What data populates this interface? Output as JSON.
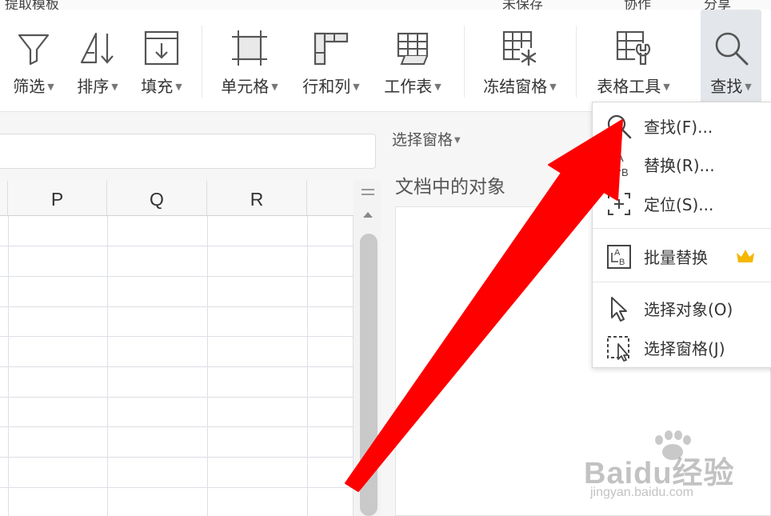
{
  "top_strip": {
    "left_text": "提取模板",
    "mid_text": "未保存",
    "mid2_text": "协作",
    "right_text": "分享"
  },
  "toolbar": {
    "tools": [
      {
        "label": "筛选",
        "icon": "filter-icon"
      },
      {
        "label": "排序",
        "icon": "sort-icon"
      },
      {
        "label": "填充",
        "icon": "fill-icon"
      },
      {
        "label": "单元格",
        "icon": "cell-icon"
      },
      {
        "label": "行和列",
        "icon": "rows-columns-icon"
      },
      {
        "label": "工作表",
        "icon": "worksheet-icon"
      },
      {
        "label": "冻结窗格",
        "icon": "freeze-panes-icon"
      },
      {
        "label": "表格工具",
        "icon": "table-tools-icon"
      },
      {
        "label": "查找",
        "icon": "search-icon"
      }
    ]
  },
  "sheet": {
    "columns": [
      "P",
      "Q",
      "R"
    ]
  },
  "pane": {
    "header": "选择窗格",
    "title": "文档中的对象"
  },
  "find_menu": {
    "items": [
      {
        "label": "查找(F)...",
        "icon": "search-icon"
      },
      {
        "label": "替换(R)...",
        "icon": "replace-icon"
      },
      {
        "label": "定位(S)...",
        "icon": "locate-icon"
      },
      {
        "label": "批量替换",
        "icon": "batch-replace-icon",
        "badge": "crown-icon"
      },
      {
        "label": "选择对象(O)",
        "icon": "cursor-icon"
      },
      {
        "label": "选择窗格(J)",
        "icon": "selection-pane-icon"
      }
    ]
  },
  "colors": {
    "arrow": "#ff0000",
    "crown": "#f5b700",
    "active_tool_bg": "#e3e6ea"
  },
  "watermark": {
    "brand": "Baidu经验",
    "url": "jingyan.baidu.com"
  }
}
